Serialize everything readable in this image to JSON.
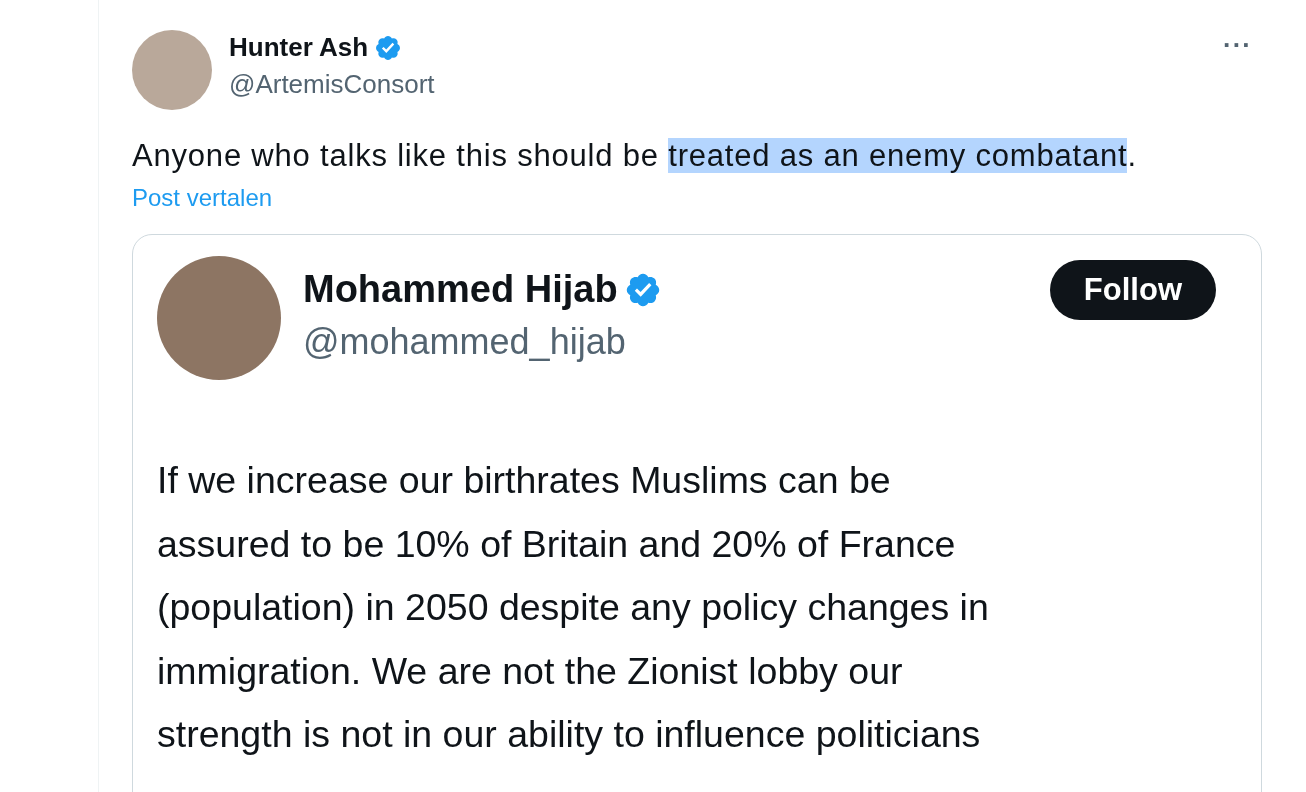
{
  "post": {
    "author": {
      "name": "Hunter Ash",
      "verified": true,
      "handle": "@ArtemisConsort"
    },
    "more": "···",
    "text_segments": [
      {
        "text": "Anyone who talks like this should be ",
        "highlighted": false
      },
      {
        "text": "treated as an enemy combatant",
        "highlighted": true
      },
      {
        "text": ".",
        "highlighted": false
      }
    ],
    "translate_link": "Post vertalen",
    "quoted": {
      "author": {
        "name": "Mohammed Hijab",
        "verified": true,
        "handle": "@mohammed_hijab"
      },
      "follow_button": "Follow",
      "text_lines": [
        "If we increase our birthrates Muslims can be",
        "assured to be 10% of Britain and 20% of France",
        "(population) in 2050 despite any policy changes in",
        "immigration. We are not the Zionist lobby our",
        "strength is not in our ability to influence politicians"
      ]
    }
  }
}
